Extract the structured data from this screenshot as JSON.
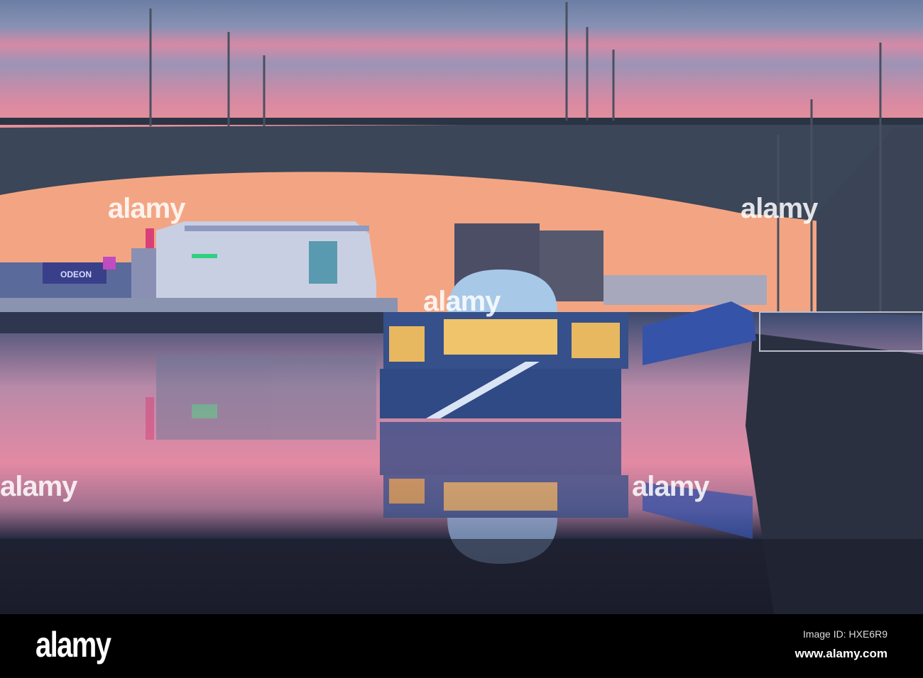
{
  "photo": {
    "subject": "bridge-over-river-at-sunset",
    "colors": {
      "sky_top": "#6f7fa3",
      "sky_pink": "#e3899e",
      "sky_glow": "#f1a585",
      "bridge": "#3b4658",
      "water_dark": "#1c2032",
      "restaurant": "#3c5f9f",
      "window_light": "#f2c46a"
    },
    "signs": {
      "cinema": "ODEON"
    }
  },
  "watermark": {
    "overlay_text": "alamy",
    "logo": "alamy",
    "image_id": "Image ID: HXE6R9",
    "url": "www.alamy.com"
  }
}
